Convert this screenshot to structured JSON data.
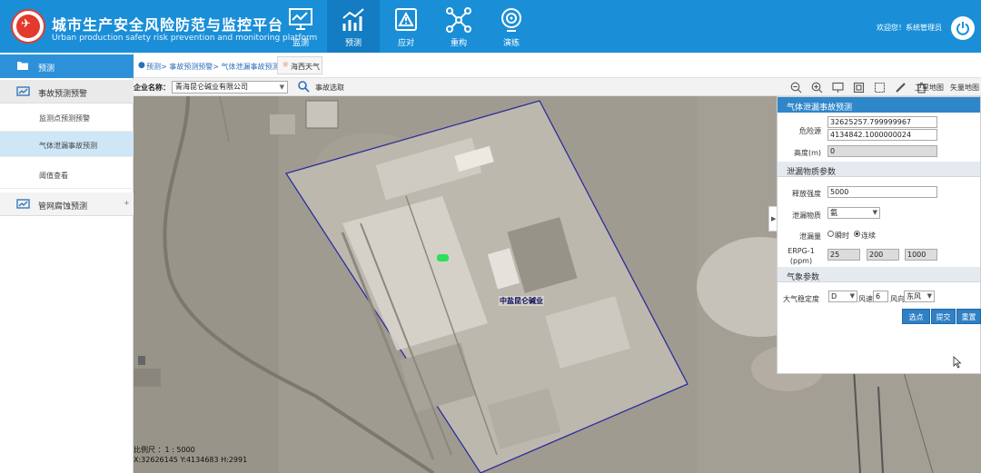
{
  "header": {
    "title_cn": "城市生产安全风险防范与监控平台",
    "title_en": "Urban production safety risk prevention and monitoring platform",
    "nav": [
      {
        "label": "监测",
        "icon": "monitor-chart-icon"
      },
      {
        "label": "预测",
        "icon": "trend-chart-icon",
        "active": true
      },
      {
        "label": "应对",
        "icon": "warning-icon"
      },
      {
        "label": "重构",
        "icon": "network-icon"
      },
      {
        "label": "演练",
        "icon": "target-icon"
      }
    ],
    "welcome": "欢迎您！系统管理员",
    "colors": {
      "header_bg": "#1a8fd8",
      "active_nav": "#137cc2"
    }
  },
  "sidebar": {
    "top": "预测",
    "groups": [
      {
        "label": "事故预测预警",
        "icon": "chart-monitor-icon",
        "expanded": true,
        "items": [
          {
            "label": "监测点预测预警"
          },
          {
            "label": "气体泄漏事故预测",
            "active": true
          },
          {
            "label": "阈值查看"
          }
        ]
      },
      {
        "label": "管网腐蚀预测",
        "icon": "chart-monitor-icon",
        "expanded": false
      }
    ]
  },
  "breadcrumb": {
    "path": "预测> 事故预测预警> 气体泄漏事故预测",
    "weather_tab": "海西天气"
  },
  "toolbar": {
    "enterprise_label": "企业名称：",
    "enterprise_value": "青海昆仑碱业有限公司",
    "pick_label": "事故选取",
    "map_satellite": "卫星地图",
    "map_vector": "矢量地图"
  },
  "map": {
    "site_label": "中盐昆仑碱业",
    "scale": "比例尺 ：1 : 5000",
    "coords": "X:32626145 Y:4134683 H:2991"
  },
  "panel": {
    "title": "气体泄漏事故预测",
    "hazard_label": "危险源",
    "hazard_x": "32625257.799999967",
    "hazard_y": "4134842.1000000024",
    "height_label": "高度(m)",
    "height_value": "0",
    "leak_section": "泄漏物质参数",
    "release_label": "释放强度",
    "release_value": "5000",
    "substance_label": "泄漏物质",
    "substance_value": "氨",
    "leak_mode_label": "泄漏量",
    "mode_instant": "瞬时",
    "mode_continuous": "连续",
    "mode_selected": "连续",
    "erpg_label": "ERPG-1 (ppm)",
    "erpg_values": [
      "25",
      "200",
      "1000"
    ],
    "weather_section": "气象参数",
    "stability_label": "大气稳定度",
    "stability_value": "D",
    "wind_speed_label": "风速",
    "wind_speed_value": "6",
    "wind_dir_label": "风向",
    "wind_dir_value": "东风",
    "btn_pick": "选点",
    "btn_submit": "提交",
    "btn_reset": "重置"
  }
}
